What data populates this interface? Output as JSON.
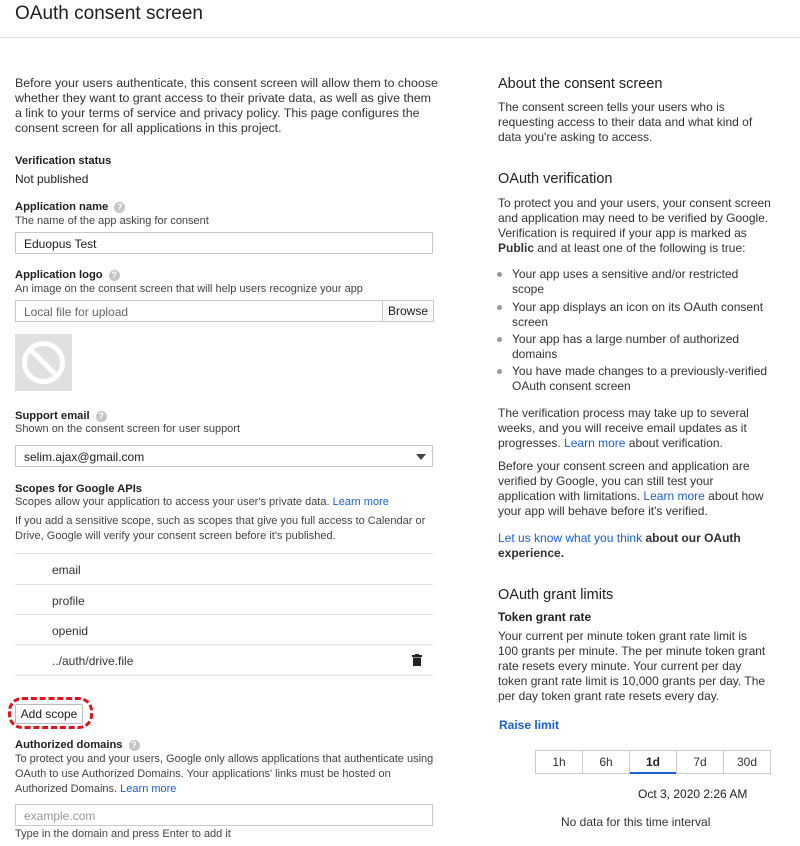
{
  "page_title": "OAuth consent screen",
  "intro": "Before your users authenticate, this consent screen will allow them to choose whether they want to grant access to their private data, as well as give them a link to your terms of service and privacy policy. This page configures the consent screen for all applications in this project.",
  "verification": {
    "label": "Verification status",
    "value": "Not published"
  },
  "app_name": {
    "label": "Application name",
    "help": "The name of the app asking for consent",
    "value": "Eduopus Test"
  },
  "app_logo": {
    "label": "Application logo",
    "help": "An image on the consent screen that will help users recognize your app",
    "placeholder": "Local file for upload",
    "browse": "Browse"
  },
  "support_email": {
    "label": "Support email",
    "help": "Shown on the consent screen for user support",
    "value": "selim.ajax@gmail.com"
  },
  "scopes": {
    "label": "Scopes for Google APIs",
    "help": "Scopes allow your application to access your user's private data.",
    "learn_more": "Learn more",
    "note": "If you add a sensitive scope, such as scopes that give you full access to Calendar or Drive, Google will verify your consent screen before it's published.",
    "items": [
      "email",
      "profile",
      "openid",
      "../auth/drive.file"
    ],
    "add_button": "Add scope"
  },
  "domains": {
    "label": "Authorized domains",
    "help": "To protect you and your users, Google only allows applications that authenticate using OAuth to use Authorized Domains. Your applications' links must be hosted on Authorized Domains.",
    "learn_more": "Learn more",
    "placeholder": "example.com",
    "hint": "Type in the domain and press Enter to add it"
  },
  "about": {
    "title": "About the consent screen",
    "text": "The consent screen tells your users who is requesting access to their data and what kind of data you're asking to access."
  },
  "verify": {
    "title": "OAuth verification",
    "p1": "To protect you and your users, your consent screen and application may need to be verified by Google. Verification is required if your app is marked as",
    "p1_bold": "Public",
    "p1_tail": "and at least one of the following is true:",
    "bullets": [
      "Your app uses a sensitive and/or restricted scope",
      "Your app displays an icon on its OAuth consent screen",
      "Your app has a large number of authorized domains",
      "You have made changes to a previously-verified OAuth consent screen"
    ],
    "p2": "The verification process may take up to several weeks, and you will receive email updates as it progresses.",
    "p2_link": "Learn more",
    "p2_tail": "about verification.",
    "p3": "Before your consent screen and application are verified by Google, you can still test your application with limitations.",
    "p3_link": "Learn more",
    "p3_tail": "about how your app will behave before it's verified.",
    "feedback_link": "Let us know what you think",
    "feedback_tail": "about our OAuth experience."
  },
  "limits": {
    "title": "OAuth grant limits",
    "subtitle": "Token grant rate",
    "text": "Your current per minute token grant rate limit is 100 grants per minute. The per minute token grant rate resets every minute. Your current per day token grant rate limit is 10,000 grants per day. The per day token grant rate resets every day.",
    "raise": "Raise limit",
    "tabs": [
      "1h",
      "6h",
      "1d",
      "7d",
      "30d"
    ],
    "active_tab": "1d",
    "timestamp": "Oct 3, 2020 2:26 AM",
    "no_data": "No data for this time interval"
  }
}
